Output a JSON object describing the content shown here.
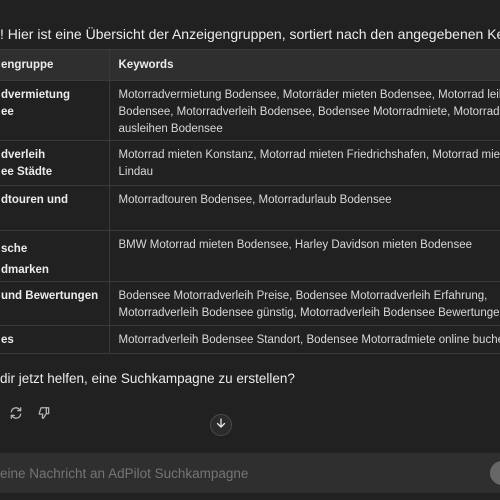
{
  "intro_text": "! Hier ist eine Übersicht der Anzeigengruppen, sortiert nach den angegebenen Keywords:",
  "table": {
    "headers": [
      "engruppe",
      "Keywords"
    ],
    "rows": [
      {
        "group": [
          "dvermietung",
          "ee"
        ],
        "keywords": [
          "Motorradvermietung Bodensee, Motorräder mieten Bodensee, Motorrad leihen",
          "Bodensee, Motorradverleih Bodensee, Bodensee Motorradmiete, Motorrad",
          "ausleihen Bodensee"
        ]
      },
      {
        "group": [
          "dverleih",
          "ee Städte"
        ],
        "keywords": [
          "Motorrad mieten Konstanz, Motorrad mieten Friedrichshafen, Motorrad mieten",
          "Lindau"
        ]
      },
      {
        "group": [
          "dtouren und"
        ],
        "keywords": [
          "Motorradtouren Bodensee, Motorradurlaub Bodensee"
        ]
      },
      {
        "group": [
          "sche",
          "dmarken"
        ],
        "keywords": [
          "BMW Motorrad mieten Bodensee, Harley Davidson mieten Bodensee"
        ]
      },
      {
        "group": [
          "und Bewertungen"
        ],
        "keywords": [
          "Bodensee Motorradverleih Preise, Bodensee Motorradverleih Erfahrung,",
          "Motorradverleih Bodensee günstig, Motorradverleih Bodensee Bewertungen"
        ]
      },
      {
        "group": [
          "es"
        ],
        "keywords": [
          "Motorradverleih Bodensee Standort, Bodensee Motorradmiete online buchen"
        ]
      }
    ]
  },
  "followup_text": " dir jetzt helfen, eine Suchkampagne zu erstellen?",
  "actions": {
    "regenerate_icon": "regenerate-icon",
    "thumbs_down_icon": "thumbs-down-icon"
  },
  "scroll_icon": "arrow-down-icon",
  "composer": {
    "placeholder": "eine Nachricht an AdPilot Suchkampagne"
  }
}
